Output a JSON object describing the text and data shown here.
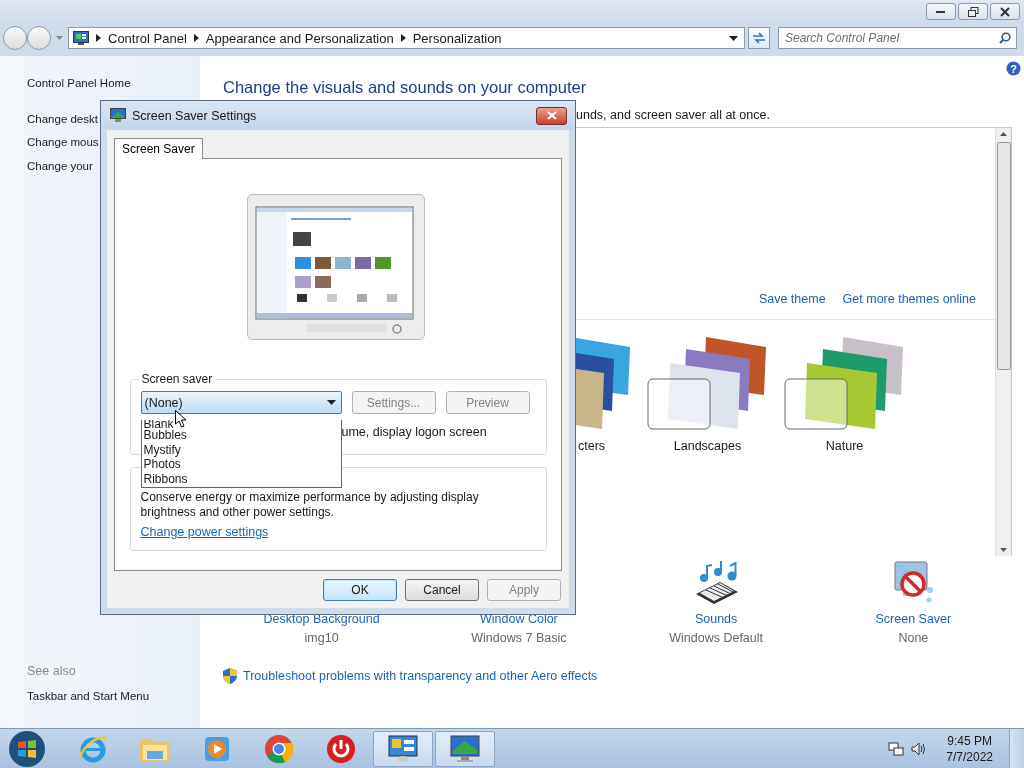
{
  "address_bar": {
    "breadcrumbs": [
      "Control Panel",
      "Appearance and Personalization",
      "Personalization"
    ]
  },
  "search": {
    "placeholder": "Search Control Panel"
  },
  "sidebar": {
    "links": [
      "Control Panel Home",
      "Change deskt",
      "Change mous",
      "Change your"
    ],
    "see_also_heading": "See also",
    "see_also_links": [
      "Taskbar and Start Menu"
    ]
  },
  "main": {
    "help_icon": "?",
    "heading": "Change the visuals and sounds on your computer",
    "description": "unds, and screen saver all at once.",
    "theme_links": [
      "Save theme",
      "Get more themes online"
    ],
    "themes": [
      {
        "name": "cters",
        "kind": "characters"
      },
      {
        "name": "Landscapes",
        "kind": "landscapes"
      },
      {
        "name": "Nature",
        "kind": "nature"
      }
    ],
    "settings": [
      {
        "kind": "wallpaper",
        "label": "Desktop Background",
        "value": "img10"
      },
      {
        "kind": "window-color",
        "label": "Window Color",
        "value": "Windows 7 Basic"
      },
      {
        "kind": "sounds",
        "label": "Sounds",
        "value": "Windows Default"
      },
      {
        "kind": "screensaver",
        "label": "Screen Saver",
        "value": "None"
      }
    ],
    "troubleshoot_link": "Troubleshoot problems with transparency and other Aero effects"
  },
  "dialog": {
    "title": "Screen Saver Settings",
    "tabs": [
      {
        "label": "Screen Saver",
        "selected": true
      }
    ],
    "screen_saver_group": {
      "label": "Screen saver",
      "value": "(None)",
      "expanded": true,
      "options": [
        {
          "label": "Blank",
          "selected": false
        },
        {
          "label": "Bubbles",
          "selected": false
        },
        {
          "label": "Mystify",
          "selected": false
        },
        {
          "label": "Photos",
          "selected": false
        },
        {
          "label": "Ribbons",
          "selected": false
        }
      ],
      "buttons": [
        {
          "label": "Settings...",
          "disabled": true
        },
        {
          "label": "Preview",
          "disabled": true
        }
      ],
      "logon_text": "ume, display logon screen"
    },
    "power_group": {
      "text": "Conserve energy or maximize performance by adjusting display brightness and other power settings.",
      "link": "Change power settings"
    },
    "buttons": [
      {
        "label": "OK",
        "default": true,
        "disabled": false
      },
      {
        "label": "Cancel",
        "default": false,
        "disabled": false
      },
      {
        "label": "Apply",
        "default": false,
        "disabled": true
      }
    ]
  },
  "taskbar": {
    "apps": [
      {
        "kind": "ie",
        "active": false
      },
      {
        "kind": "explorer",
        "active": false
      },
      {
        "kind": "media",
        "active": false
      },
      {
        "kind": "chrome",
        "active": false
      },
      {
        "kind": "power",
        "active": false
      },
      {
        "kind": "control-panel",
        "active": true
      },
      {
        "kind": "screensaver",
        "active": true
      }
    ],
    "clock": {
      "time": "9:45 PM",
      "date": "7/7/2022"
    }
  }
}
